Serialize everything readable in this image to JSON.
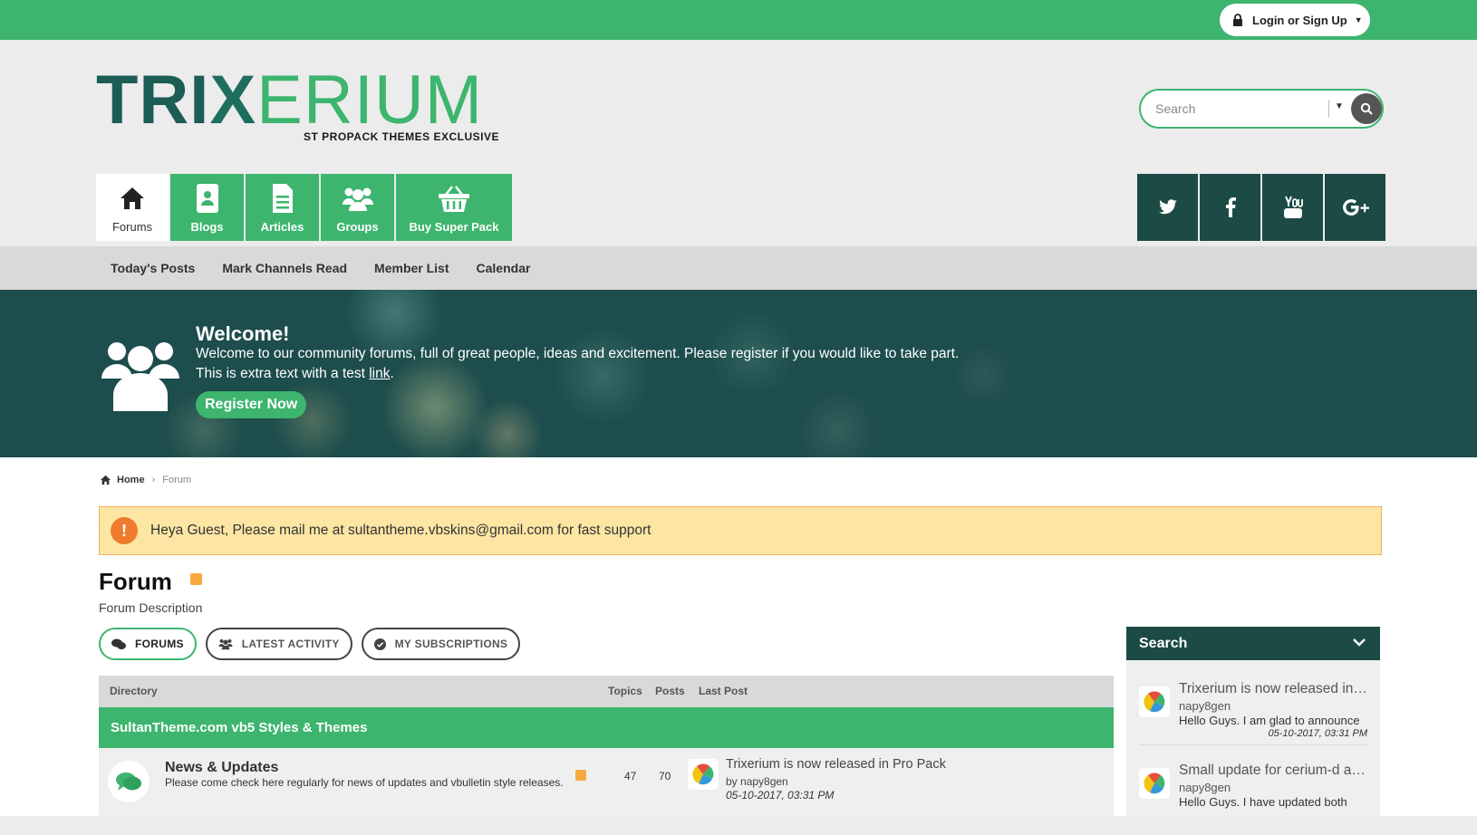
{
  "topbar": {
    "login_label": "Login or Sign Up"
  },
  "logo": {
    "part1": "TRI",
    "part2": "X",
    "part3": "ERIUM",
    "tagline": "ST PROPACK THEMES EXCLUSIVE"
  },
  "search": {
    "placeholder": "Search"
  },
  "nav": {
    "tabs": [
      {
        "label": "Forums",
        "icon": "home-icon"
      },
      {
        "label": "Blogs",
        "icon": "blog-icon"
      },
      {
        "label": "Articles",
        "icon": "article-icon"
      },
      {
        "label": "Groups",
        "icon": "groups-icon"
      },
      {
        "label": "Buy Super Pack",
        "icon": "basket-icon"
      }
    ]
  },
  "social": {
    "items": [
      "twitter-icon",
      "facebook-icon",
      "youtube-icon",
      "google-plus-icon"
    ]
  },
  "subnav": {
    "items": [
      "Today's Posts",
      "Mark Channels Read",
      "Member List",
      "Calendar"
    ]
  },
  "banner": {
    "title": "Welcome!",
    "text": "Welcome to our community forums, full of great people, ideas and excitement. Please register if you would like to take part.",
    "text2_prefix": "This is extra text with a test ",
    "text2_link": "link",
    "text2_suffix": ".",
    "register_label": "Register Now"
  },
  "breadcrumb": {
    "home": "Home",
    "current": "Forum"
  },
  "notice": {
    "text": "Heya Guest, Please mail me at sultantheme.vbskins@gmail.com for fast support"
  },
  "forum": {
    "title": "Forum",
    "description": "Forum Description"
  },
  "tabs": [
    "FORUMS",
    "LATEST ACTIVITY",
    "MY SUBSCRIPTIONS"
  ],
  "directory": {
    "headers": {
      "directory": "Directory",
      "topics": "Topics",
      "posts": "Posts",
      "last_post": "Last Post"
    },
    "channel": "SultanTheme.com vb5 Styles & Themes",
    "rows": [
      {
        "name": "News & Updates",
        "description": "Please come check here regularly for news of updates and vbulletin style releases.",
        "topics": "47",
        "posts": "70",
        "last_post_title": "Trixerium is now released in Pro Pack",
        "last_post_by": "by napy8gen",
        "last_post_date": "05-10-2017, 03:31 PM"
      }
    ]
  },
  "sidebar": {
    "title": "Search",
    "items": [
      {
        "title": "Trixerium is now released in Pro Pack",
        "user": "napy8gen",
        "message": "Hello Guys. I am glad to announce",
        "date": "05-10-2017, 03:31 PM"
      },
      {
        "title": "Small update for cerium-d and others",
        "user": "napy8gen",
        "message": "Hello Guys. I have updated both",
        "date": ""
      }
    ]
  },
  "colors": {
    "primary_green": "#3db56e",
    "dark_teal": "#1c4a44",
    "notice_bg": "#fde6a4",
    "notice_icon": "#ef7b2e",
    "rss": "#f7a940"
  }
}
